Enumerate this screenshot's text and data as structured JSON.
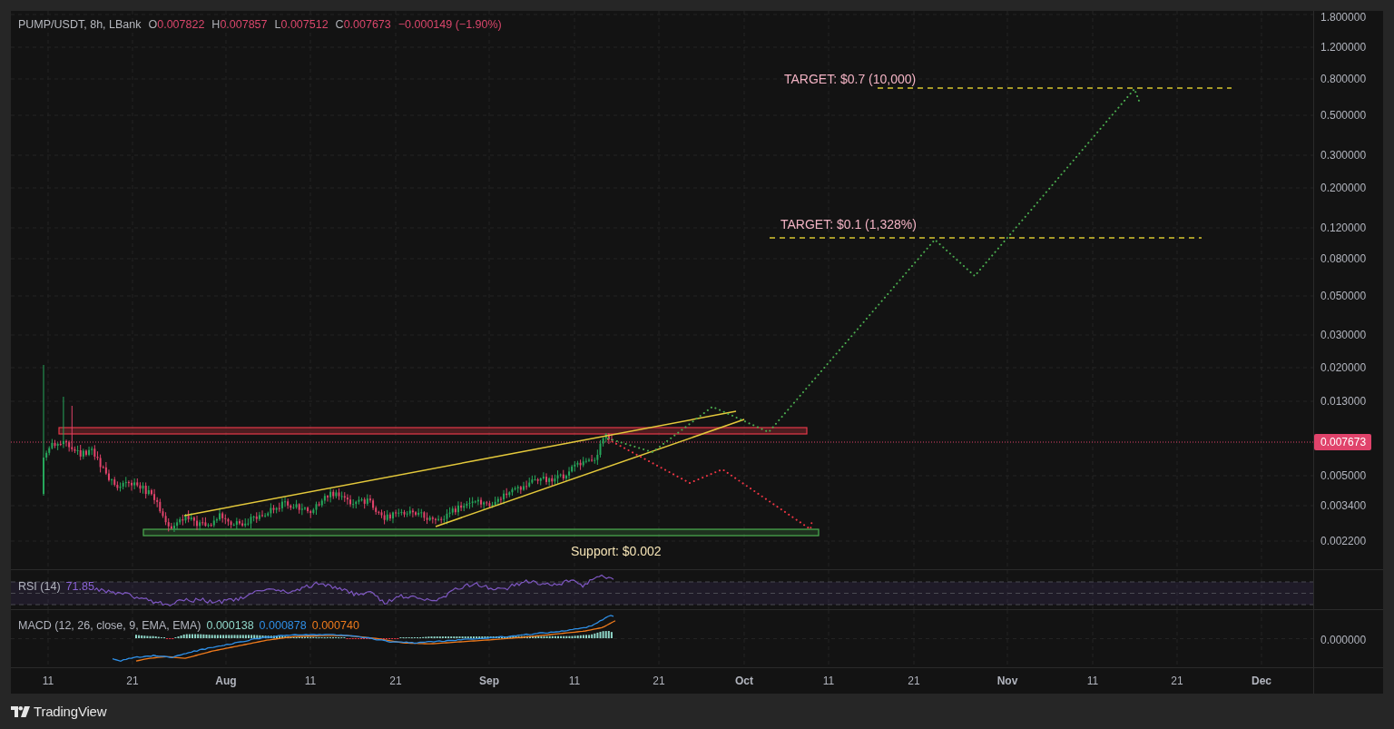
{
  "header": {
    "symbol": "PUMP/USDT, 8h, LBank",
    "ohlc": [
      {
        "label": "O",
        "value": "0.007822"
      },
      {
        "label": "H",
        "value": "0.007857"
      },
      {
        "label": "L",
        "value": "0.007512"
      },
      {
        "label": "C",
        "value": "0.007673"
      }
    ],
    "change": "−0.000149 (−1.90%)"
  },
  "annotations": {
    "targets": [
      "TARGET: $0.7 (10,000)",
      "TARGET: $0.1 (1,328%)"
    ],
    "support": "Support: $0.002"
  },
  "price_axis": {
    "labels": [
      "1.800000",
      "1.200000",
      "0.800000",
      "0.500000",
      "0.300000",
      "0.200000",
      "0.120000",
      "0.080000",
      "0.050000",
      "0.030000",
      "0.020000",
      "0.013000",
      "0.005000",
      "0.003400",
      "0.002200"
    ],
    "current_price": "0.007673"
  },
  "rsi": {
    "title": "RSI (14)",
    "value": "71.85"
  },
  "macd": {
    "title": "MACD (12, 26, close, 9, EMA, EMA)",
    "values": [
      {
        "text": "0.000138",
        "color": "#8fd6c8"
      },
      {
        "text": "0.000878",
        "color": "#2f8fe6"
      },
      {
        "text": "0.000740",
        "color": "#ee7a1c"
      }
    ],
    "axis_label": "0.000000"
  },
  "time_axis": {
    "labels": [
      {
        "text": "11",
        "kind": "day"
      },
      {
        "text": "21",
        "kind": "day"
      },
      {
        "text": "Aug",
        "kind": "month"
      },
      {
        "text": "11",
        "kind": "day"
      },
      {
        "text": "21",
        "kind": "day"
      },
      {
        "text": "Sep",
        "kind": "month"
      },
      {
        "text": "11",
        "kind": "day"
      },
      {
        "text": "21",
        "kind": "day"
      },
      {
        "text": "Oct",
        "kind": "month"
      },
      {
        "text": "11",
        "kind": "day"
      },
      {
        "text": "21",
        "kind": "day"
      },
      {
        "text": "Nov",
        "kind": "month"
      },
      {
        "text": "11",
        "kind": "day"
      },
      {
        "text": "21",
        "kind": "day"
      },
      {
        "text": "Dec",
        "kind": "month"
      }
    ]
  },
  "footer": {
    "brand": "TradingView"
  }
}
